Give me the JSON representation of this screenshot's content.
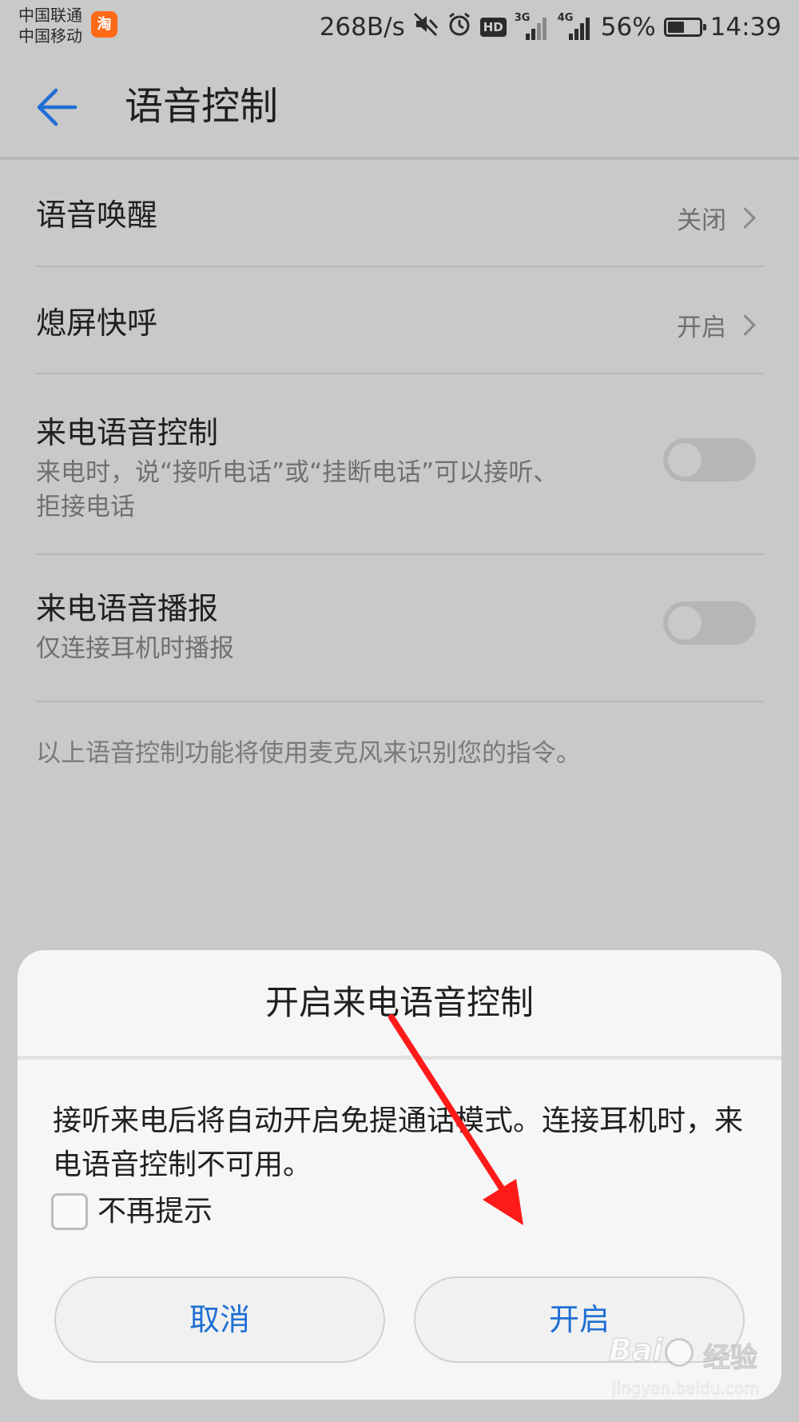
{
  "status_bar": {
    "carrier_1": "中国联通",
    "carrier_2": "中国移动",
    "app_badge": "淘",
    "net_speed": "268B/s",
    "hd_label": "HD",
    "sim1_gen": "3G",
    "sim2_gen": "4G",
    "battery": "56%",
    "battery_level": 0.56,
    "time": "14:39",
    "icons": [
      "mute-icon",
      "alarm-icon",
      "hd-icon",
      "signal-icon",
      "signal-icon",
      "battery-icon"
    ]
  },
  "header": {
    "title": "语音控制",
    "back_icon": "arrow-left-icon",
    "accent_color": "#1e6fd4"
  },
  "settings": {
    "voice_wakeup": {
      "label": "语音唤醒",
      "value": "关闭"
    },
    "screen_off_call": {
      "label": "熄屏快呼",
      "value": "开启"
    },
    "incoming_voice_control": {
      "label": "来电语音控制",
      "summary": "来电时，说“接听电话”或“挂断电话”可以接听、拒接电话",
      "enabled": false
    },
    "incoming_voice_announce": {
      "label": "来电语音播报",
      "summary": "仅连接耳机时播报",
      "enabled": false
    },
    "footnote": "以上语音控制功能将使用麦克风来识别您的指令。"
  },
  "dialog": {
    "title": "开启来电语音控制",
    "message": "接听来电后将自动开启免提通话模式。连接耳机时，来电语音控制不可用。",
    "checkbox_label": "不再提示",
    "checkbox_checked": false,
    "cancel_label": "取消",
    "confirm_label": "开启",
    "button_text_color": "#1e6fd4"
  },
  "annotation": {
    "arrow_color": "#ff1a1a"
  },
  "watermark": {
    "logo_left": "Bai",
    "logo_right": "经验",
    "url": "jingyan.baidu.com"
  }
}
